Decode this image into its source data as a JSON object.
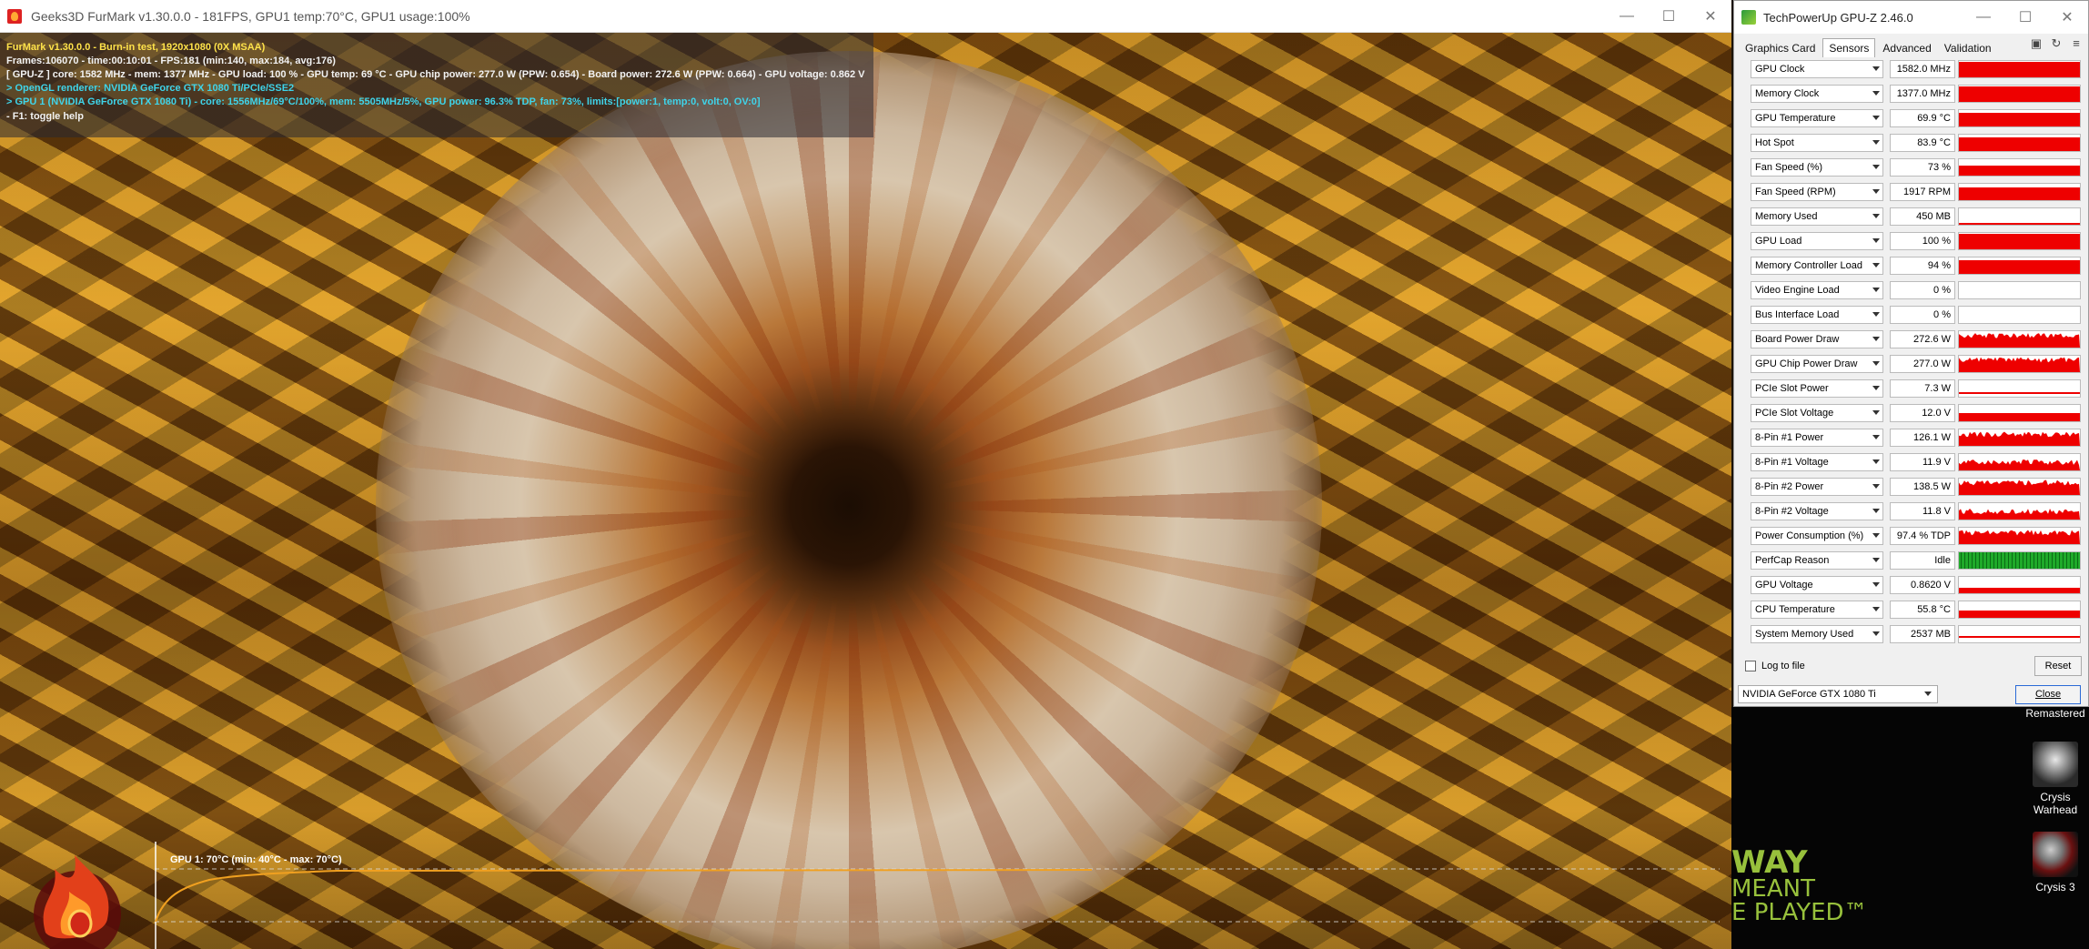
{
  "furmark": {
    "title": "Geeks3D FurMark v1.30.0.0 - 181FPS, GPU1 temp:70°C, GPU1 usage:100%",
    "osd": {
      "line1": "FurMark v1.30.0.0 - Burn-in test, 1920x1080 (0X MSAA)",
      "line2": "Frames:106070 - time:00:10:01 - FPS:181 (min:140, max:184, avg:176)",
      "line3": "[ GPU-Z ] core: 1582 MHz - mem: 1377 MHz - GPU load: 100 % - GPU temp: 69 °C - GPU chip power: 277.0 W (PPW: 0.654) - Board power: 272.6 W (PPW: 0.664) - GPU voltage: 0.862 V",
      "line4": "> OpenGL renderer: NVIDIA GeForce GTX 1080 Ti/PCIe/SSE2",
      "line5": "> GPU 1 (NVIDIA GeForce GTX 1080 Ti) - core: 1556MHz/69°C/100%, mem: 5505MHz/5%, GPU power: 96.3% TDP, fan: 73%, limits:[power:1, temp:0, volt:0, OV:0]",
      "line6": "- F1: toggle help"
    },
    "graph_label": "GPU 1: 70°C (min: 40°C - max: 70°C)",
    "colors": {
      "osd_yellow": "#ffe34a",
      "osd_cyan": "#3fd4ea",
      "graph_line": "#f0a020"
    }
  },
  "gpuz": {
    "title": "TechPowerUp GPU-Z 2.46.0",
    "tabs": [
      "Graphics Card",
      "Sensors",
      "Advanced",
      "Validation"
    ],
    "active_tab": "Sensors",
    "sensors": [
      {
        "name": "GPU Clock",
        "value": "1582.0 MHz",
        "graph": "solid",
        "level": 0.95
      },
      {
        "name": "Memory Clock",
        "value": "1377.0 MHz",
        "graph": "solid",
        "level": 0.95
      },
      {
        "name": "GPU Temperature",
        "value": "69.9 °C",
        "graph": "solid",
        "level": 0.85
      },
      {
        "name": "Hot Spot",
        "value": "83.9 °C",
        "graph": "solid",
        "level": 0.85
      },
      {
        "name": "Fan Speed (%)",
        "value": "73 %",
        "graph": "solid",
        "level": 0.6
      },
      {
        "name": "Fan Speed (RPM)",
        "value": "1917 RPM",
        "graph": "solid",
        "level": 0.8
      },
      {
        "name": "Memory Used",
        "value": "450 MB",
        "graph": "solid",
        "level": 0.08
      },
      {
        "name": "GPU Load",
        "value": "100 %",
        "graph": "solid",
        "level": 0.95
      },
      {
        "name": "Memory Controller Load",
        "value": "94 %",
        "graph": "solid",
        "level": 0.85
      },
      {
        "name": "Video Engine Load",
        "value": "0 %",
        "graph": "none",
        "level": 0
      },
      {
        "name": "Bus Interface Load",
        "value": "0 %",
        "graph": "none",
        "level": 0
      },
      {
        "name": "Board Power Draw",
        "value": "272.6 W",
        "graph": "noisy",
        "level": 0.75
      },
      {
        "name": "GPU Chip Power Draw",
        "value": "277.0 W",
        "graph": "noisy",
        "level": 0.75
      },
      {
        "name": "PCIe Slot Power",
        "value": "7.3 W",
        "graph": "line",
        "level": 0.15
      },
      {
        "name": "PCIe Slot Voltage",
        "value": "12.0 V",
        "graph": "solid",
        "level": 0.5
      },
      {
        "name": "8-Pin #1 Power",
        "value": "126.1 W",
        "graph": "noisy",
        "level": 0.7
      },
      {
        "name": "8-Pin #1 Voltage",
        "value": "11.9 V",
        "graph": "noisy",
        "level": 0.5
      },
      {
        "name": "8-Pin #2 Power",
        "value": "138.5 W",
        "graph": "noisy",
        "level": 0.75
      },
      {
        "name": "8-Pin #2 Voltage",
        "value": "11.8 V",
        "graph": "noisy",
        "level": 0.5
      },
      {
        "name": "Power Consumption (%)",
        "value": "97.4 % TDP",
        "graph": "noisy",
        "level": 0.7
      },
      {
        "name": "PerfCap Reason",
        "value": "Idle",
        "graph": "green",
        "level": 1
      },
      {
        "name": "GPU Voltage",
        "value": "0.8620 V",
        "graph": "solid",
        "level": 0.35
      },
      {
        "name": "CPU Temperature",
        "value": "55.8 °C",
        "graph": "solid",
        "level": 0.45
      },
      {
        "name": "System Memory Used",
        "value": "2537 MB",
        "graph": "line",
        "level": 0.3
      }
    ],
    "log_label": "Log to file",
    "reset_label": "Reset",
    "device": "NVIDIA GeForce GTX 1080 Ti",
    "close_label": "Close",
    "colors": {
      "graph_red": "#ee0000",
      "graph_green": "#1faa2a"
    }
  },
  "desktop": {
    "icons": [
      {
        "label": "Remastered"
      },
      {
        "label": "Crysis Warhead"
      },
      {
        "label": "Crysis 3"
      }
    ],
    "banner": {
      "line1": "WAY",
      "line2": "MEANT",
      "line3": "E PLAYED™"
    }
  }
}
